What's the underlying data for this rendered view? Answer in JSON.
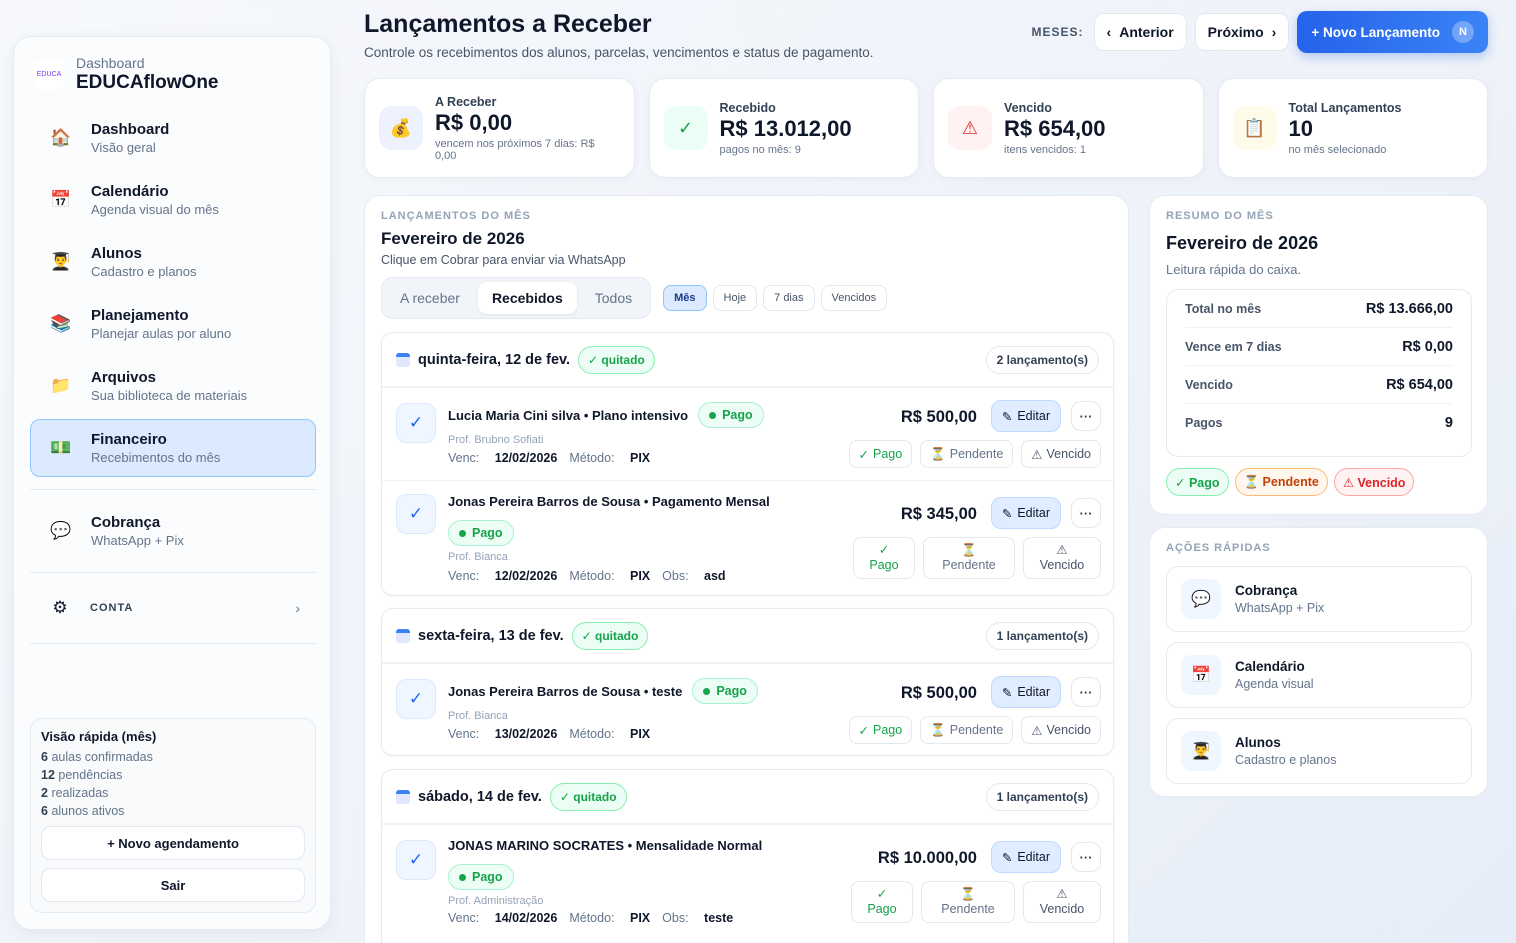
{
  "brand": {
    "logo_text": "EDUCA",
    "sub": "Dashboard",
    "title": "EDUCAflowOne"
  },
  "nav": [
    {
      "icon": "house-icon",
      "glyph": "🏠",
      "label": "Dashboard",
      "sub": "Visão geral"
    },
    {
      "icon": "calendar-icon",
      "glyph": "📅",
      "label": "Calendário",
      "sub": "Agenda visual do mês"
    },
    {
      "icon": "student-icon",
      "glyph": "👨‍🎓",
      "label": "Alunos",
      "sub": "Cadastro e planos"
    },
    {
      "icon": "books-icon",
      "glyph": "📚",
      "label": "Planejamento",
      "sub": "Planejar aulas por aluno"
    },
    {
      "icon": "folder-icon",
      "glyph": "📁",
      "label": "Arquivos",
      "sub": "Sua biblioteca de materiais"
    },
    {
      "icon": "money-icon",
      "glyph": "💵",
      "label": "Financeiro",
      "sub": "Recebimentos do mês"
    }
  ],
  "cobranca": {
    "label": "Cobrança",
    "sub": "WhatsApp + Pix"
  },
  "conta": {
    "label": "CONTA",
    "chevron": "›"
  },
  "quick": {
    "title": "Visão rápida (mês)",
    "lines": [
      {
        "n": "6",
        "t": "aulas confirmadas"
      },
      {
        "n": "12",
        "t": "pendências"
      },
      {
        "n": "2",
        "t": "realizadas"
      },
      {
        "n": "6",
        "t": "alunos ativos"
      }
    ],
    "new_btn": "+ Novo agendamento",
    "logout_btn": "Sair"
  },
  "header": {
    "title": "Lançamentos a Receber",
    "subtitle": "Controle os recebimentos dos alunos, parcelas, vencimentos e status de pagamento.",
    "meses_label": "MESES:",
    "prev": "Anterior",
    "next": "Próximo",
    "new": "+ Novo Lançamento",
    "new_key": "N"
  },
  "kpis": [
    {
      "label": "A Receber",
      "value": "R$ 0,00",
      "note": "vencem nos próximos 7 dias: R$ 0,00",
      "icon": "money-bag-icon",
      "glyph": "💰",
      "bg": "#eef2ff"
    },
    {
      "label": "Recebido",
      "value": "R$ 13.012,00",
      "note": "pagos no mês: 9",
      "icon": "check-icon",
      "glyph": "✓",
      "bg": "#ecfdf5"
    },
    {
      "label": "Vencido",
      "value": "R$ 654,00",
      "note": "itens vencidos: 1",
      "icon": "warning-icon",
      "glyph": "⚠",
      "bg": "#fef2f2"
    },
    {
      "label": "Total Lançamentos",
      "value": "10",
      "note": "no mês selecionado",
      "icon": "clipboard-icon",
      "glyph": "📋",
      "bg": "#fffbeb"
    }
  ],
  "main": {
    "caption": "LANÇAMENTOS DO MÊS",
    "title": "Fevereiro de 2026",
    "subtitle": "Clique em Cobrar para enviar via WhatsApp",
    "tabs": [
      "A receber",
      "Recebidos",
      "Todos"
    ],
    "filters": [
      "Mês",
      "Hoje",
      "7 dias",
      "Vencidos"
    ]
  },
  "groups": [
    {
      "day": "quinta-feira, 12 de fev.",
      "status": "✓ quitado",
      "count": "2 lançamento(s)",
      "entries": [
        {
          "title": "Lucia Maria Cini silva • Plano intensivo",
          "badge": "Pago",
          "prof": "Prof. Brubno Sofiati",
          "venc_label": "Venc:",
          "venc": "12/02/2026",
          "metodo_label": "Método:",
          "metodo": "PIX",
          "amount": "R$ 500,00"
        },
        {
          "title": "Jonas Pereira Barros de Sousa • Pagamento Mensal",
          "badge": "Pago",
          "prof": "Prof. Bianca",
          "venc_label": "Venc:",
          "venc": "12/02/2026",
          "metodo_label": "Método:",
          "metodo": "PIX",
          "obs_label": "Obs:",
          "obs": "asd",
          "amount": "R$ 345,00"
        }
      ]
    },
    {
      "day": "sexta-feira, 13 de fev.",
      "status": "✓ quitado",
      "count": "1 lançamento(s)",
      "entries": [
        {
          "title": "Jonas Pereira Barros de Sousa • teste",
          "badge": "Pago",
          "prof": "Prof. Bianca",
          "venc_label": "Venc:",
          "venc": "13/02/2026",
          "metodo_label": "Método:",
          "metodo": "PIX",
          "amount": "R$ 500,00"
        }
      ]
    },
    {
      "day": "sábado, 14 de fev.",
      "status": "✓ quitado",
      "count": "1 lançamento(s)",
      "entries": [
        {
          "title": "JONAS MARINO SOCRATES • Mensalidade Normal",
          "badge": "Pago",
          "prof": "Prof. Administração",
          "venc_label": "Venc:",
          "venc": "14/02/2026",
          "metodo_label": "Método:",
          "metodo": "PIX",
          "obs_label": "Obs:",
          "obs": "teste",
          "amount": "R$ 10.000,00"
        }
      ]
    }
  ],
  "actions_common": {
    "edit": "Editar",
    "more": "···",
    "pago": "Pago",
    "pendente": "Pendente",
    "vencido": "Vencido",
    "pago_glyph": "✓",
    "pend_glyph": "⏳",
    "venc_glyph": "⚠",
    "edit_glyph": "✎"
  },
  "summary": {
    "caption": "RESUMO DO MÊS",
    "title": "Fevereiro de 2026",
    "subtitle": "Leitura rápida do caixa.",
    "rows": [
      {
        "k": "Total no mês",
        "v": "R$ 13.666,00"
      },
      {
        "k": "Vence em 7 dias",
        "v": "R$ 0,00"
      },
      {
        "k": "Vencido",
        "v": "R$ 654,00"
      },
      {
        "k": "Pagos",
        "v": "9"
      }
    ],
    "legend": [
      "✓ Pago",
      "⏳ Pendente",
      "⚠ Vencido"
    ]
  },
  "quick_actions": {
    "caption": "AÇÕES RÁPIDAS",
    "items": [
      {
        "label": "Cobrança",
        "sub": "WhatsApp + Pix",
        "icon": "chat-bubble-icon",
        "glyph": "💬"
      },
      {
        "label": "Calendário",
        "sub": "Agenda visual",
        "icon": "calendar-icon",
        "glyph": "📅"
      },
      {
        "label": "Alunos",
        "sub": "Cadastro e planos",
        "icon": "student-icon",
        "glyph": "👨‍🎓"
      }
    ]
  }
}
